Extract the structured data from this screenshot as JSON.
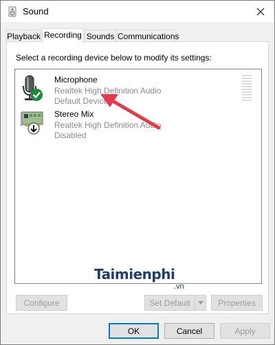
{
  "window": {
    "title": "Sound"
  },
  "tabs": [
    {
      "label": "Playback"
    },
    {
      "label": "Recording"
    },
    {
      "label": "Sounds"
    },
    {
      "label": "Communications"
    }
  ],
  "panel": {
    "instruction": "Select a recording device below to modify its settings:",
    "devices": [
      {
        "name": "Microphone",
        "description": "Realtek High Definition Audio",
        "status": "Default Device"
      },
      {
        "name": "Stereo Mix",
        "description": "Realtek High Definition Audio",
        "status": "Disabled"
      }
    ],
    "configure_label": "Configure",
    "set_default_label": "Set Default",
    "properties_label": "Properties"
  },
  "footer": {
    "ok_label": "OK",
    "cancel_label": "Cancel",
    "apply_label": "Apply"
  },
  "watermark": {
    "brand": "Taimienphi",
    "suffix": ".vn"
  },
  "colors": {
    "accent": "#0078d7",
    "annotation_arrow": "#e8394a",
    "check_green": "#1e8a3a"
  }
}
